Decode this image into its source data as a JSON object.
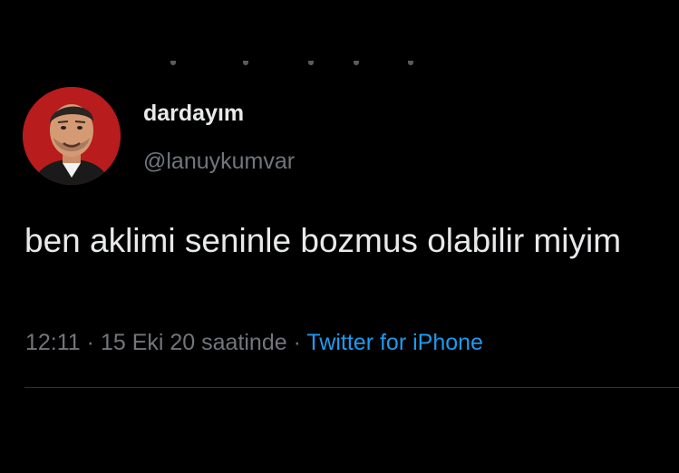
{
  "tweet": {
    "display_name": "dardayım",
    "handle": "@lanuykumvar",
    "text": "ben aklimi seninle bozmus olabilir miyim",
    "time": "12:11",
    "separator_1": " · ",
    "date": "15 Eki 20 saatinde",
    "separator_2": " · ",
    "source": "Twitter for iPhone"
  },
  "colors": {
    "background": "#000000",
    "text_primary": "#e7e9ea",
    "text_secondary": "#71767b",
    "link": "#1d9bf0",
    "avatar_bg": "#b81c1c"
  }
}
